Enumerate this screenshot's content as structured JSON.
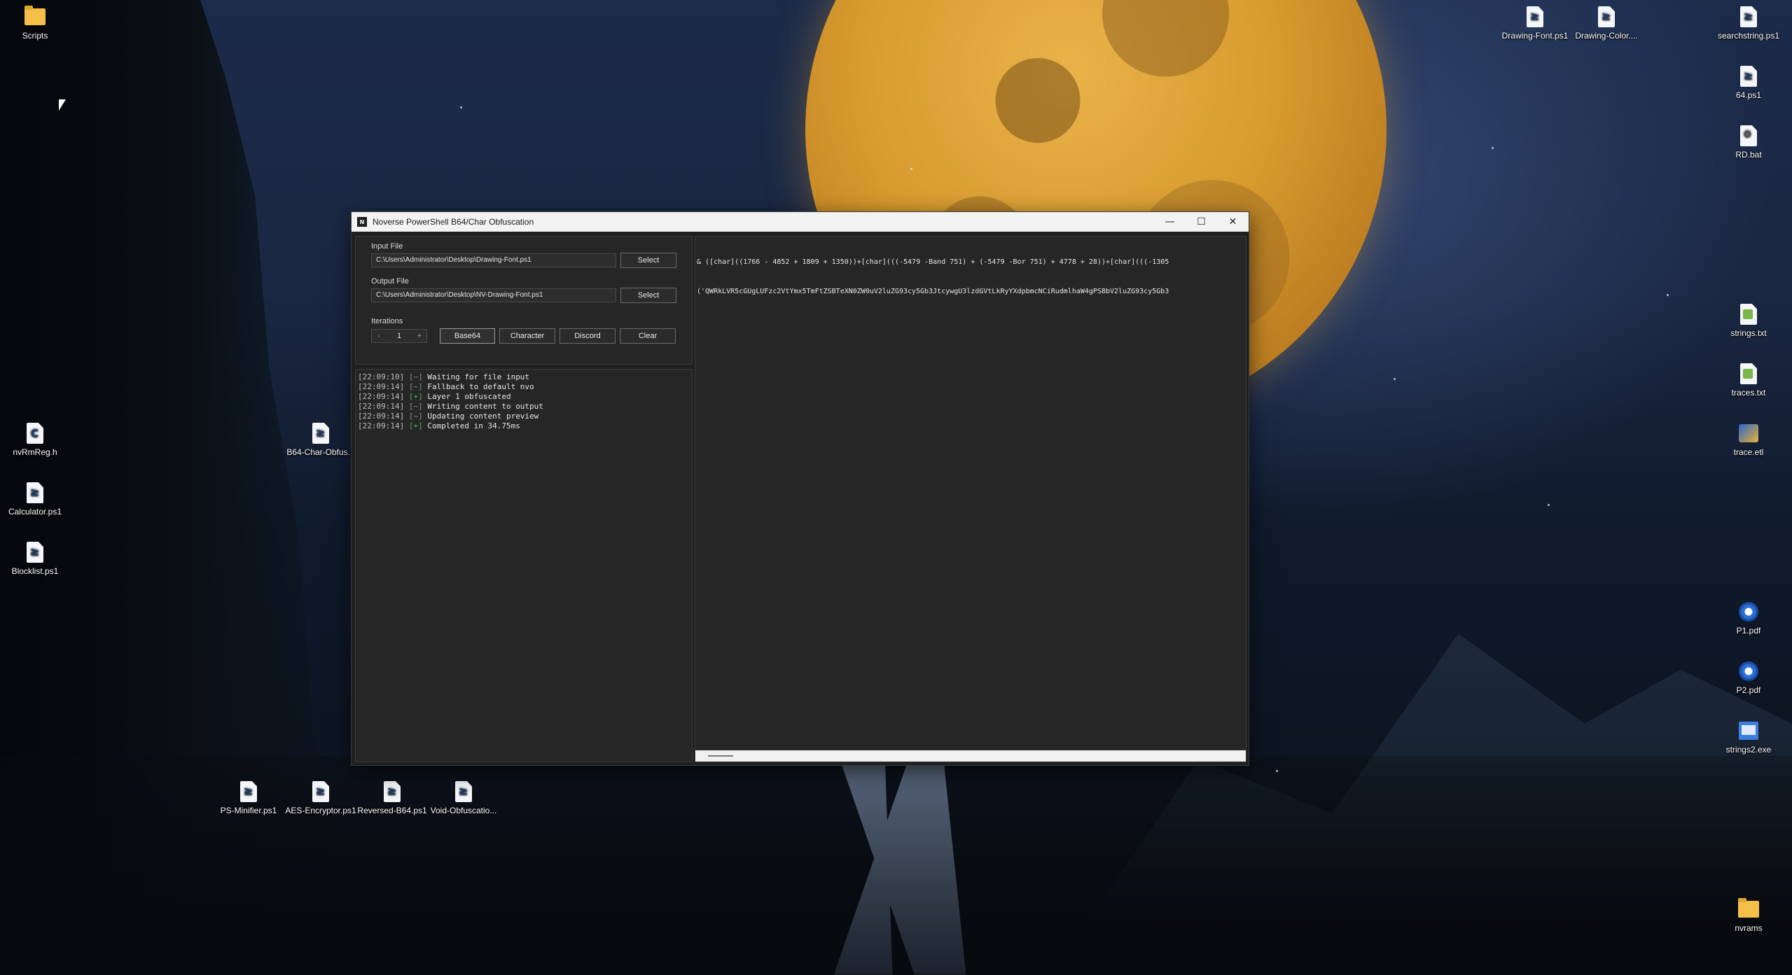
{
  "desktop": {
    "icons_left": [
      {
        "label": "Scripts",
        "icon": "folder-icon"
      },
      {
        "label": "nvRmReg.h",
        "icon": "c-header-file-icon"
      },
      {
        "label": "Calculator.ps1",
        "icon": "powershell-file-icon"
      },
      {
        "label": "Blocklist.ps1",
        "icon": "powershell-file-icon"
      },
      {
        "label": "B64-Char-Obfus...",
        "icon": "powershell-file-icon"
      }
    ],
    "icons_bottom": [
      {
        "label": "PS-Minifier.ps1",
        "icon": "powershell-file-icon"
      },
      {
        "label": "AES-Encryptor.ps1",
        "icon": "powershell-file-icon"
      },
      {
        "label": "Reversed-B64.ps1",
        "icon": "powershell-file-icon"
      },
      {
        "label": "Void-Obfuscatio...",
        "icon": "powershell-file-icon"
      }
    ],
    "icons_top_right": [
      {
        "label": "Drawing-Font.ps1",
        "icon": "powershell-file-icon"
      },
      {
        "label": "Drawing-Color....",
        "icon": "powershell-file-icon"
      }
    ],
    "icons_right": [
      {
        "label": "searchstring.ps1",
        "icon": "powershell-file-icon"
      },
      {
        "label": "64.ps1",
        "icon": "powershell-file-icon"
      },
      {
        "label": "RD.bat",
        "icon": "batch-file-icon"
      },
      {
        "label": "strings.txt",
        "icon": "text-file-icon"
      },
      {
        "label": "traces.txt",
        "icon": "text-file-icon"
      },
      {
        "label": "trace.etl",
        "icon": "etl-file-icon"
      },
      {
        "label": "P1.pdf",
        "icon": "pdf-file-icon"
      },
      {
        "label": "P2.pdf",
        "icon": "pdf-file-icon"
      },
      {
        "label": "strings2.exe",
        "icon": "exe-file-icon"
      },
      {
        "label": "nvrams",
        "icon": "folder-icon"
      }
    ]
  },
  "window": {
    "title": "Noverse PowerShell B64/Char Obfuscation",
    "app_icon_text": "N",
    "controls": {
      "minimize": "—",
      "maximize": "☐",
      "close": "✕"
    },
    "input_file": {
      "label": "Input File",
      "value": "C:\\Users\\Administrator\\Desktop\\Drawing-Font.ps1",
      "button": "Select"
    },
    "output_file": {
      "label": "Output File",
      "value": "C:\\Users\\Administrator\\Desktop\\NV-Drawing-Font.ps1",
      "button": "Select"
    },
    "iterations": {
      "label": "Iterations",
      "decrement": "-",
      "value": "1",
      "increment": "+"
    },
    "mode_buttons": {
      "base64": "Base64",
      "character": "Character",
      "discord": "Discord",
      "clear": "Clear"
    },
    "log": [
      {
        "time": "[22:09:10]",
        "tag": "[~]",
        "kind": "wait",
        "msg": "Waiting for file input"
      },
      {
        "time": "[22:09:14]",
        "tag": "[~]",
        "kind": "wait",
        "msg": "Fallback to default nvo"
      },
      {
        "time": "[22:09:14]",
        "tag": "[+]",
        "kind": "ok",
        "msg": "Layer 1 obfuscated"
      },
      {
        "time": "[22:09:14]",
        "tag": "[~]",
        "kind": "wait",
        "msg": "Writing content to output"
      },
      {
        "time": "[22:09:14]",
        "tag": "[~]",
        "kind": "wait",
        "msg": "Updating content preview"
      },
      {
        "time": "[22:09:14]",
        "tag": "[+]",
        "kind": "ok",
        "msg": "Completed in 34.75ms"
      }
    ],
    "preview": {
      "line1": "& ([char]((1766 - 4852 + 1809 + 1350))+[char](((-5479 -Band 751) + (-5479 -Bor 751) + 4778 + 28))+[char](((-1305",
      "line2": "('QWRkLVR5cGUgLUFzc2VtYmx5TmFtZSBTeXN0ZW0uV2luZG93cy5Gb3JtcywgU3lzdGVtLkRyYXdpbmcNCiRudmlhaW4gPSBbV2luZG93cy5Gb3"
    }
  },
  "colors": {
    "window_bg": "#1f1f1f",
    "panel_bg": "#262626",
    "titlebar_bg": "#f3f3f3",
    "log_ok": "#4caf50",
    "log_wait": "#8a8a8a"
  }
}
